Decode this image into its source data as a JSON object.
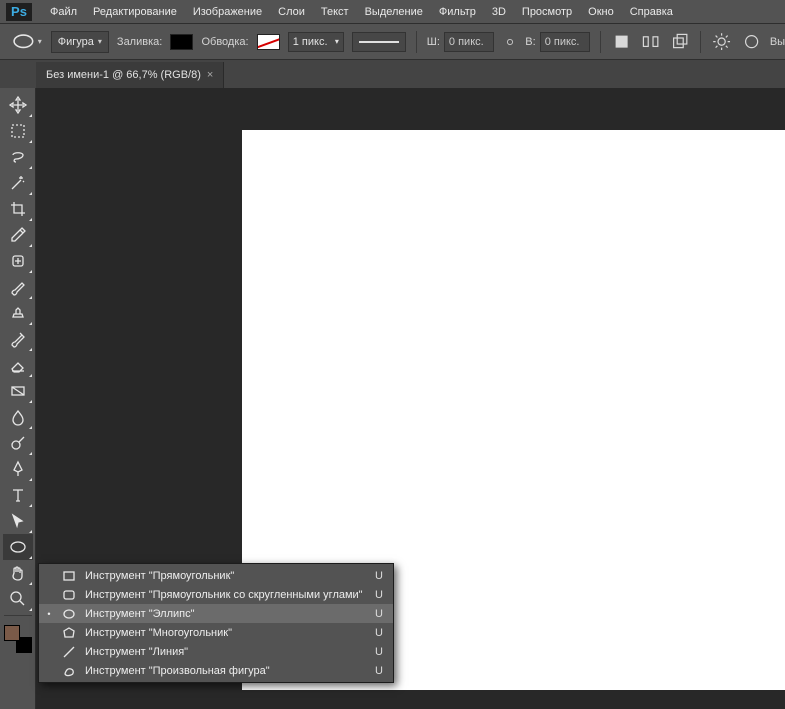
{
  "app": {
    "logo": "Ps"
  },
  "menu": [
    "Файл",
    "Редактирование",
    "Изображение",
    "Слои",
    "Текст",
    "Выделение",
    "Фильтр",
    "3D",
    "Просмотр",
    "Окно",
    "Справка"
  ],
  "options": {
    "shape_dd": "Фигура",
    "fill_label": "Заливка:",
    "stroke_label": "Обводка:",
    "stroke_width": "1 пикс.",
    "w_label": "Ш:",
    "w_value": "0 пикс.",
    "h_label": "В:",
    "h_value": "0 пикс.",
    "right_btn": "Вы"
  },
  "tab": {
    "title": "Без имени-1 @ 66,7% (RGB/8)"
  },
  "flyout": {
    "items": [
      {
        "icon": "rect",
        "label": "Инструмент \"Прямоугольник\"",
        "key": "U",
        "selected": false
      },
      {
        "icon": "roundrect",
        "label": "Инструмент \"Прямоугольник со скругленными углами\"",
        "key": "U",
        "selected": false
      },
      {
        "icon": "ellipse",
        "label": "Инструмент \"Эллипс\"",
        "key": "U",
        "selected": true
      },
      {
        "icon": "polygon",
        "label": "Инструмент \"Многоугольник\"",
        "key": "U",
        "selected": false
      },
      {
        "icon": "line",
        "label": "Инструмент \"Линия\"",
        "key": "U",
        "selected": false
      },
      {
        "icon": "customshape",
        "label": "Инструмент \"Произвольная фигура\"",
        "key": "U",
        "selected": false
      }
    ]
  }
}
